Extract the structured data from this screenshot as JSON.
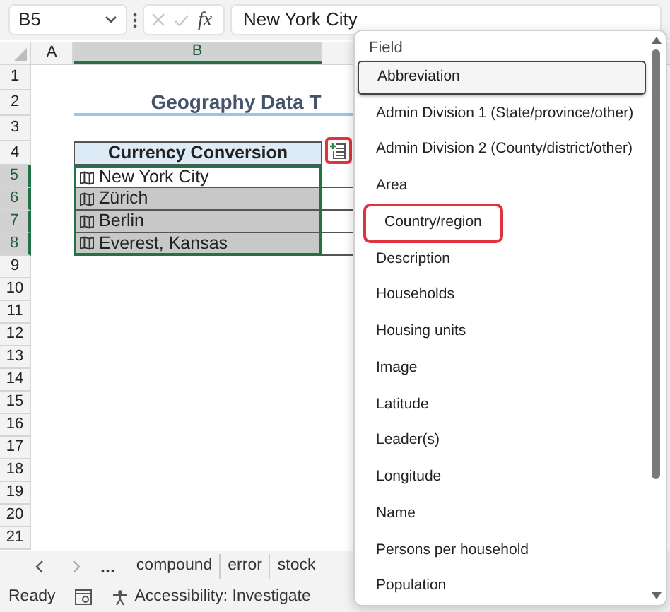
{
  "formula_bar": {
    "name_box": "B5",
    "function_label": "fx",
    "value": "New York City"
  },
  "column_headers": [
    {
      "label": "A",
      "selected": false
    },
    {
      "label": "B",
      "selected": true
    }
  ],
  "row_numbers": [
    {
      "label": "1",
      "selected": false
    },
    {
      "label": "2",
      "selected": false
    },
    {
      "label": "3",
      "selected": false
    },
    {
      "label": "4",
      "selected": false
    },
    {
      "label": "5",
      "selected": true
    },
    {
      "label": "6",
      "selected": true
    },
    {
      "label": "7",
      "selected": true
    },
    {
      "label": "8",
      "selected": true
    },
    {
      "label": "9",
      "selected": false
    },
    {
      "label": "10",
      "selected": false
    },
    {
      "label": "11",
      "selected": false
    },
    {
      "label": "12",
      "selected": false
    },
    {
      "label": "13",
      "selected": false
    },
    {
      "label": "14",
      "selected": false
    },
    {
      "label": "15",
      "selected": false
    },
    {
      "label": "16",
      "selected": false
    },
    {
      "label": "17",
      "selected": false
    },
    {
      "label": "18",
      "selected": false
    },
    {
      "label": "19",
      "selected": false
    },
    {
      "label": "20",
      "selected": false
    },
    {
      "label": "21",
      "selected": false
    }
  ],
  "sheet": {
    "title": "Geography Data T",
    "table_header": "Currency Conversion",
    "rows": [
      {
        "value": "New York City",
        "active": true
      },
      {
        "value": "Zürich",
        "active": false
      },
      {
        "value": "Berlin",
        "active": false
      },
      {
        "value": "Everest, Kansas",
        "active": false
      }
    ]
  },
  "field_menu": {
    "header": "Field",
    "items": [
      {
        "label": "Abbreviation",
        "selected": true,
        "annotated": false
      },
      {
        "label": "Admin Division 1 (State/province/other)",
        "selected": false,
        "annotated": false
      },
      {
        "label": "Admin Division 2 (County/district/other)",
        "selected": false,
        "annotated": false
      },
      {
        "label": "Area",
        "selected": false,
        "annotated": false
      },
      {
        "label": "Country/region",
        "selected": false,
        "annotated": true
      },
      {
        "label": "Description",
        "selected": false,
        "annotated": false
      },
      {
        "label": "Households",
        "selected": false,
        "annotated": false
      },
      {
        "label": "Housing units",
        "selected": false,
        "annotated": false
      },
      {
        "label": "Image",
        "selected": false,
        "annotated": false
      },
      {
        "label": "Latitude",
        "selected": false,
        "annotated": false
      },
      {
        "label": "Leader(s)",
        "selected": false,
        "annotated": false
      },
      {
        "label": "Longitude",
        "selected": false,
        "annotated": false
      },
      {
        "label": "Name",
        "selected": false,
        "annotated": false
      },
      {
        "label": "Persons per household",
        "selected": false,
        "annotated": false
      },
      {
        "label": "Population",
        "selected": false,
        "annotated": false
      }
    ]
  },
  "sheet_tabs": {
    "more": "...",
    "tabs": [
      {
        "label": "compound"
      },
      {
        "label": "error"
      },
      {
        "label": "stock"
      }
    ]
  },
  "status_bar": {
    "status": "Ready",
    "accessibility": "Accessibility: Investigate"
  }
}
